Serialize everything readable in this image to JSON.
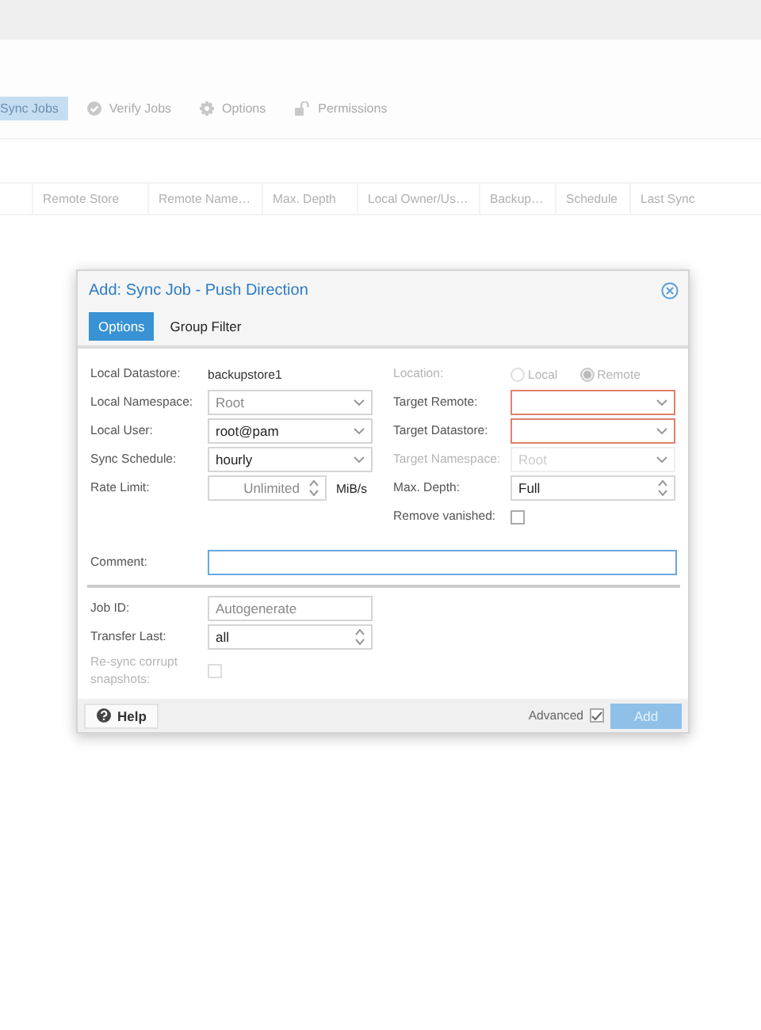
{
  "app_tabs": [
    {
      "label": "Sync Jobs",
      "selected": true
    },
    {
      "label": "Verify Jobs",
      "selected": false
    },
    {
      "label": "Options",
      "selected": false
    },
    {
      "label": "Permissions",
      "selected": false
    }
  ],
  "table": {
    "columns": [
      "Remote Store",
      "Remote Name…",
      "Max. Depth",
      "Local Owner/Us…",
      "Backup…",
      "Schedule",
      "Last Sync"
    ]
  },
  "dialog": {
    "title": "Add: Sync Job - Push Direction",
    "tabs": [
      {
        "label": "Options",
        "selected": true
      },
      {
        "label": "Group Filter",
        "selected": false
      }
    ],
    "left_fields": [
      {
        "kind": "display",
        "label": "Local Datastore:",
        "value": "backupstore1",
        "disabled": false
      },
      {
        "kind": "combo",
        "label": "Local Namespace:",
        "placeholder": "Root",
        "disabled": false,
        "invalid": false
      },
      {
        "kind": "combo",
        "label": "Local User:",
        "value": "root@pam",
        "disabled": false,
        "invalid": false
      },
      {
        "kind": "combo",
        "label": "Sync Schedule:",
        "value": "hourly",
        "disabled": false,
        "invalid": false
      },
      {
        "kind": "spinner",
        "label": "Rate Limit:",
        "placeholder": "Unlimited",
        "unit": "MiB/s",
        "disabled": false,
        "invalid": false
      }
    ],
    "right_fields": [
      {
        "kind": "radio",
        "label": "Location:",
        "disabled": true,
        "options": [
          {
            "label": "Local",
            "selected": false
          },
          {
            "label": "Remote",
            "selected": true
          }
        ]
      },
      {
        "kind": "combo",
        "label": "Target Remote:",
        "disabled": false,
        "invalid": true
      },
      {
        "kind": "combo",
        "label": "Target Datastore:",
        "disabled": false,
        "invalid": true
      },
      {
        "kind": "combo",
        "label": "Target Namespace:",
        "placeholder": "Root",
        "disabled": true,
        "invalid": false
      },
      {
        "kind": "spinner",
        "label": "Max. Depth:",
        "value": "Full",
        "disabled": false,
        "invalid": false
      },
      {
        "kind": "checkbox",
        "label": "Remove vanished:",
        "checked": false,
        "disabled": false
      }
    ],
    "comment": {
      "kind": "text",
      "label": "Comment:",
      "focused": true,
      "disabled": false,
      "invalid": false
    },
    "advanced_fields": [
      {
        "kind": "text",
        "label": "Job ID:",
        "placeholder": "Autogenerate",
        "disabled": false,
        "invalid": false
      },
      {
        "kind": "spinner",
        "label": "Transfer Last:",
        "value": "all",
        "disabled": false,
        "invalid": false
      },
      {
        "kind": "checkbox",
        "label": "Re-sync corrupt snapshots:",
        "checked": false,
        "disabled": true
      }
    ],
    "footer": {
      "help": "Help",
      "advanced_label": "Advanced",
      "advanced_checked": true,
      "submit": "Add",
      "submit_disabled": true
    }
  }
}
